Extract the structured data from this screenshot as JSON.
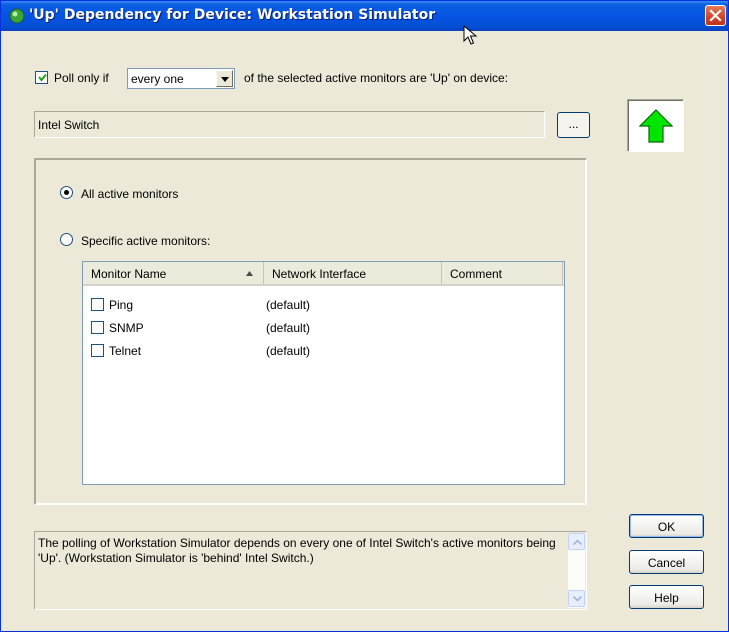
{
  "window": {
    "title": "'Up' Dependency for Device: Workstation Simulator",
    "icons": {
      "app": "green-globe-icon",
      "close": "close-icon",
      "cursor": "mouse-pointer-icon"
    }
  },
  "poll": {
    "checked": true,
    "prefix_label": "Poll only if",
    "selected_option": "every one",
    "suffix_label": "of the selected active monitors are 'Up' on device:"
  },
  "device": {
    "name": "Intel Switch",
    "browse_label": "...",
    "status_icon": "green-up-arrow-icon",
    "status_color": "#00e600"
  },
  "monitors": {
    "all_label": "All active monitors",
    "specific_label": "Specific active monitors:",
    "selected": "all",
    "columns": [
      "Monitor Name",
      "Network Interface",
      "Comment"
    ],
    "sort_column": "Monitor Name",
    "rows": [
      {
        "name": "Ping",
        "interface": "(default)",
        "comment": "",
        "checked": false
      },
      {
        "name": "SNMP",
        "interface": "(default)",
        "comment": "",
        "checked": false
      },
      {
        "name": "Telnet",
        "interface": "(default)",
        "comment": "",
        "checked": false
      }
    ]
  },
  "description": "The polling of Workstation Simulator depends on every one of Intel Switch's active monitors being 'Up'.  (Workstation Simulator is 'behind' Intel Switch.)",
  "buttons": {
    "ok": "OK",
    "cancel": "Cancel",
    "help": "Help"
  }
}
